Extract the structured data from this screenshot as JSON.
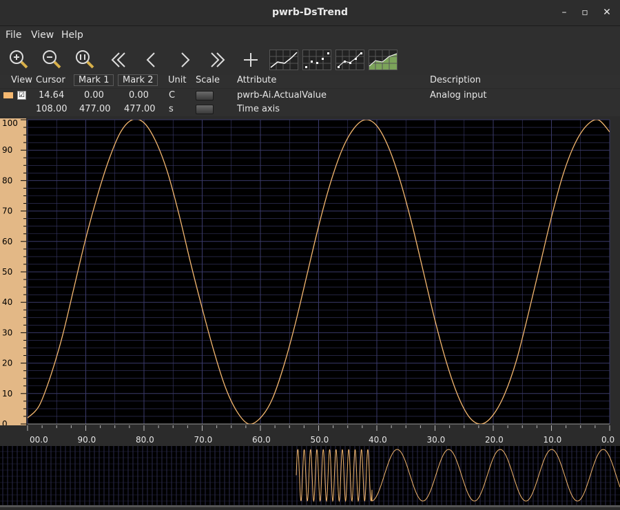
{
  "window": {
    "title": "pwrb-DsTrend"
  },
  "menu": [
    "File",
    "View",
    "Help"
  ],
  "toolbar": {
    "buttons": [
      "zoom-in-icon",
      "zoom-out-icon",
      "zoom-reset-icon",
      "page-left-icon",
      "scroll-left-icon",
      "scroll-right-icon",
      "page-right-icon",
      "add-icon",
      "line-chart-icon",
      "dot-chart-icon",
      "line-dot-chart-icon",
      "area-chart-icon"
    ]
  },
  "columns": {
    "view": "View",
    "cursor": "Cursor",
    "mark1": "Mark 1",
    "mark2": "Mark 2",
    "unit": "Unit",
    "scale": "Scale",
    "attribute": "Attribute",
    "description": "Description"
  },
  "rows": [
    {
      "color": "#f5b870",
      "checked": "☑",
      "cursor": "14.64",
      "mark1": "0.00",
      "mark2": "0.00",
      "unit": "C",
      "attribute": "pwrb-Ai.ActualValue",
      "description": "Analog input"
    },
    {
      "cursor": "108.00",
      "mark1": "477.00",
      "mark2": "477.00",
      "unit": "s",
      "attribute": "Time axis",
      "description": ""
    }
  ],
  "colors": {
    "trace": "#f5b870",
    "grid": "#3a3a6a",
    "axis_bg": "#e3b886",
    "plot_bg": "#000000"
  },
  "chart_data": {
    "type": "line",
    "title": "",
    "xlabel": "",
    "ylabel": "",
    "ylim": [
      0,
      100
    ],
    "xlim": [
      100,
      0
    ],
    "y_ticks": [
      "100",
      "90",
      "80",
      "70",
      "60",
      "50",
      "40",
      "30",
      "20",
      "10",
      "0"
    ],
    "x_ticks": [
      "00.0",
      "90.0",
      "80.0",
      "70.0",
      "60.0",
      "50.0",
      "40.0",
      "30.0",
      "20.0",
      "10.0",
      "0.0"
    ],
    "series": [
      {
        "x": [
          100,
          98,
          96,
          94,
          92,
          90,
          88,
          86,
          84,
          82,
          80,
          78,
          76,
          74,
          72,
          70,
          68,
          66,
          64,
          62,
          60,
          58,
          56,
          54,
          52,
          50,
          48,
          46,
          44,
          42,
          40,
          38,
          36,
          34,
          32,
          30,
          28,
          26,
          24,
          22,
          20,
          18,
          16,
          14,
          12,
          10,
          8,
          6,
          4,
          2,
          0
        ],
        "values": [
          2,
          6,
          16,
          29,
          45,
          61,
          75,
          87,
          96,
          100,
          99,
          93,
          83,
          69,
          53,
          38,
          24,
          12,
          4,
          0,
          2,
          8,
          19,
          33,
          49,
          65,
          79,
          90,
          97,
          100,
          98,
          91,
          80,
          66,
          50,
          34,
          20,
          9,
          2,
          0,
          3,
          10,
          21,
          36,
          52,
          68,
          82,
          92,
          98,
          100,
          96
        ]
      }
    ],
    "grid": true,
    "legend": "none"
  }
}
